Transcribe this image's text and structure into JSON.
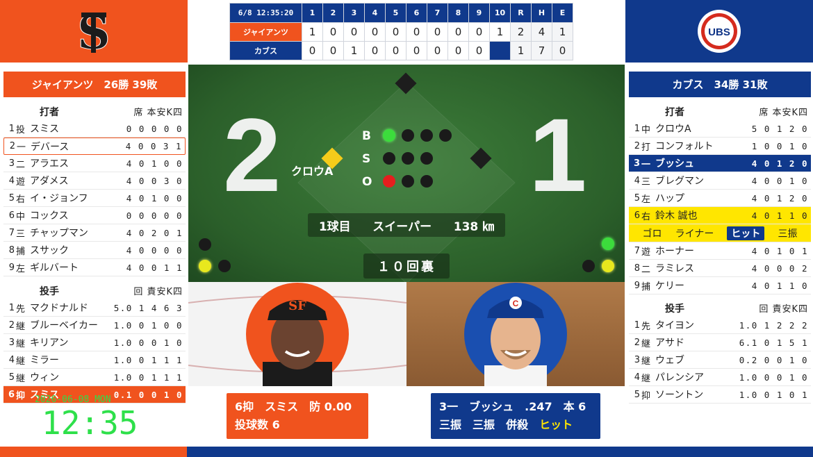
{
  "linescore": {
    "date_time": "6/8 12:35:20",
    "innings": [
      "1",
      "2",
      "3",
      "4",
      "5",
      "6",
      "7",
      "8",
      "9",
      "10"
    ],
    "totals_labels": [
      "R",
      "H",
      "E"
    ],
    "away": {
      "name": "ジャイアンツ",
      "runs": [
        "1",
        "0",
        "0",
        "0",
        "0",
        "0",
        "0",
        "0",
        "0",
        "1"
      ],
      "totals": [
        "2",
        "4",
        "1"
      ]
    },
    "home": {
      "name": "カブス",
      "runs": [
        "0",
        "0",
        "1",
        "0",
        "0",
        "0",
        "0",
        "0",
        "0",
        ""
      ],
      "totals": [
        "1",
        "7",
        "0"
      ]
    }
  },
  "left_team": {
    "banner": "ジャイアンツ　26勝 39敗",
    "batters_header": "打者",
    "batters_cols": "席 本安K四",
    "batters": [
      {
        "num": "1",
        "pos": "投",
        "name": "スミス",
        "stats": "0 0 0 0 0"
      },
      {
        "num": "2",
        "pos": "一",
        "name": "デバース",
        "stats": "4 0 0 3 1"
      },
      {
        "num": "3",
        "pos": "二",
        "name": "アラエス",
        "stats": "4 0 1 0 0"
      },
      {
        "num": "4",
        "pos": "遊",
        "name": "アダメス",
        "stats": "4 0 0 3 0"
      },
      {
        "num": "5",
        "pos": "右",
        "name": "イ・ジョンフ",
        "stats": "4 0 1 0 0"
      },
      {
        "num": "6",
        "pos": "中",
        "name": "コックス",
        "stats": "0 0 0 0 0"
      },
      {
        "num": "7",
        "pos": "三",
        "name": "チャップマン",
        "stats": "4 0 2 0 1"
      },
      {
        "num": "8",
        "pos": "捕",
        "name": "スサック",
        "stats": "4 0 0 0 0"
      },
      {
        "num": "9",
        "pos": "左",
        "name": "ギルバート",
        "stats": "4 0 0 1 1"
      }
    ],
    "pitchers_header": "投手",
    "pitchers_cols": "回 責安K四",
    "pitchers": [
      {
        "num": "1",
        "pos": "先",
        "name": "マクドナルド",
        "stats": "5.0 1 4 6 3"
      },
      {
        "num": "2",
        "pos": "継",
        "name": "ブルーベイカー",
        "stats": "1.0 0 1 0 0"
      },
      {
        "num": "3",
        "pos": "継",
        "name": "キリアン",
        "stats": "1.0 0 0 1 0"
      },
      {
        "num": "4",
        "pos": "継",
        "name": "ミラー",
        "stats": "1.0 0 1 1 1"
      },
      {
        "num": "5",
        "pos": "継",
        "name": "ウィン",
        "stats": "1.0 0 1 1 1"
      },
      {
        "num": "6",
        "pos": "抑",
        "name": "スミス",
        "stats": "0.1 0 0 1 0"
      }
    ]
  },
  "right_team": {
    "banner": "カブス　34勝 31敗",
    "batters_header": "打者",
    "batters_cols": "席 本安K四",
    "batters": [
      {
        "num": "1",
        "pos": "中",
        "name": "クロウA",
        "stats": "5 0 1 2 0"
      },
      {
        "num": "2",
        "pos": "打",
        "name": "コンフォルト",
        "stats": "1 0 0 1 0"
      },
      {
        "num": "3",
        "pos": "一",
        "name": "ブッシュ",
        "stats": "4 0 1 2 0"
      },
      {
        "num": "4",
        "pos": "三",
        "name": "ブレグマン",
        "stats": "4 0 0 1 0"
      },
      {
        "num": "5",
        "pos": "左",
        "name": "ハップ",
        "stats": "4 0 1 2 0"
      },
      {
        "num": "6",
        "pos": "右",
        "name": "鈴木 誠也",
        "stats": "4 0 1 1 0"
      },
      {
        "num": "7",
        "pos": "遊",
        "name": "ホーナー",
        "stats": "4 0 1 0 1"
      },
      {
        "num": "8",
        "pos": "二",
        "name": "ラミレス",
        "stats": "4 0 0 0 2"
      },
      {
        "num": "9",
        "pos": "捕",
        "name": "ケリー",
        "stats": "4 0 1 1 0"
      }
    ],
    "at_bat_results": [
      "ゴロ",
      "ライナー",
      "ヒット",
      "三振"
    ],
    "pitchers_header": "投手",
    "pitchers_cols": "回 責安K四",
    "pitchers": [
      {
        "num": "1",
        "pos": "先",
        "name": "タイヨン",
        "stats": "1.0 1 2 2 2"
      },
      {
        "num": "2",
        "pos": "継",
        "name": "アサド",
        "stats": "6.1 0 1 5 1"
      },
      {
        "num": "3",
        "pos": "継",
        "name": "ウェブ",
        "stats": "0.2 0 0 1 0"
      },
      {
        "num": "4",
        "pos": "継",
        "name": "パレンシア",
        "stats": "1.0 0 0 1 0"
      },
      {
        "num": "5",
        "pos": "抑",
        "name": "ソーントン",
        "stats": "1.0 0 1 0 1"
      }
    ]
  },
  "field": {
    "away_score": "2",
    "home_score": "1",
    "count_labels": [
      "B",
      "S",
      "O"
    ],
    "balls": 1,
    "strikes": 0,
    "outs": 1,
    "runner_label": "クロウA",
    "pitch_number": "1球目",
    "pitch_type": "スイーパー",
    "pitch_speed": "138 ㎞",
    "inning": "１０回裏"
  },
  "pitcher_card": {
    "line1": "6抑　スミス　防 0.00",
    "line2": "投球数 6"
  },
  "batter_card": {
    "line1": "3一　ブッシュ　.247　本 6",
    "results": [
      "三振",
      "三振",
      "併殺"
    ],
    "last": "ヒット"
  },
  "clock": {
    "date": "2026-06-08 MON",
    "time": "12:35"
  },
  "colors": {
    "giants": "#f0531e",
    "cubs": "#10398c",
    "highlight": "#ffe600"
  }
}
